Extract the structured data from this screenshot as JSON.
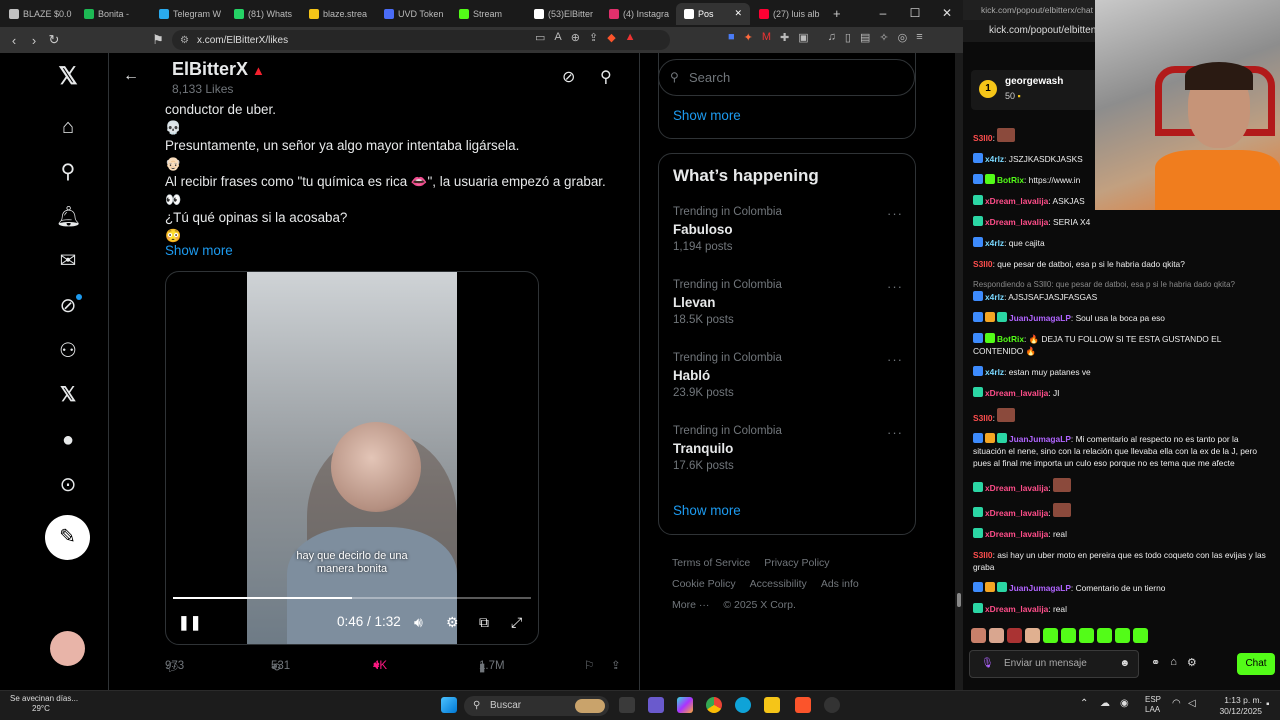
{
  "browser": {
    "tabs": [
      {
        "label": "BLAZE $0.0",
        "color": "#c0c0c0"
      },
      {
        "label": "Bonita -",
        "color": "#1db954"
      },
      {
        "label": "Telegram W",
        "color": "#2aabee"
      },
      {
        "label": "(81) Whats",
        "color": "#25d366"
      },
      {
        "label": "blaze.strea",
        "color": "#f5c518"
      },
      {
        "label": "UVD Token",
        "color": "#4a6cf7"
      },
      {
        "label": "Stream",
        "color": "#53fc18"
      },
      {
        "label": "(53)ElBitter",
        "color": "#ffffff"
      },
      {
        "label": "(4) Instagra",
        "color": "#e1306c"
      },
      {
        "label": "Pos",
        "color": "#ffffff"
      },
      {
        "label": "(27) luis alb",
        "color": "#ff0033"
      }
    ],
    "new_tab": "+",
    "url": "x.com/ElBitterX/likes",
    "window_controls": [
      "–",
      "☐",
      "✕"
    ]
  },
  "x": {
    "header": {
      "name": "ElBitterX",
      "likes": "8,133 Likes"
    },
    "post": {
      "lines": [
        {
          "text": "conductor de uber.",
          "emoji": false
        },
        {
          "text": "💀",
          "emoji": true
        },
        {
          "text": "Presuntamente, un señor ya algo mayor intentaba ligársela.",
          "emoji": false
        },
        {
          "text": "👴🏻",
          "emoji": true
        },
        {
          "text": "Al recibir frases como \"tu química es rica 👄\", la usuaria empezó a grabar.",
          "emoji": false
        },
        {
          "text": "👀",
          "emoji": true
        },
        {
          "text": "¿Tú qué opinas si la acosaba?",
          "emoji": false
        },
        {
          "text": "😳",
          "emoji": true
        }
      ],
      "show_more": "Show more",
      "video": {
        "caption_line1": "hay que decirlo de una",
        "caption_line2": "manera bonita",
        "time": "0:46 / 1:32",
        "progress": 0.5
      },
      "actions": {
        "replies": "973",
        "reposts": "531",
        "likes": "4K",
        "views": "1.7M"
      }
    },
    "sidebar": {
      "search_placeholder": "Search",
      "show_more_top": "Show more",
      "happening_title": "What’s happening",
      "trends": [
        {
          "context": "Trending in Colombia",
          "name": "Fabuloso",
          "posts": "1,194 posts"
        },
        {
          "context": "Trending in Colombia",
          "name": "Llevan",
          "posts": "18.5K posts"
        },
        {
          "context": "Trending in Colombia",
          "name": "Habló",
          "posts": "23.9K posts"
        },
        {
          "context": "Trending in Colombia",
          "name": "Tranquilo",
          "posts": "17.6K posts"
        }
      ],
      "show_more_bottom": "Show more",
      "footer": [
        "Terms of Service",
        "Privacy Policy",
        "Cookie Policy",
        "Accessibility",
        "Ads info",
        "More ···",
        "© 2025 X Corp."
      ]
    }
  },
  "kick": {
    "tab_url": "kick.com/popout/elbitterx/chat",
    "addr": "kick.com/popout/elbitten",
    "gift": {
      "user": "georgewash",
      "amount": "50"
    },
    "messages": [
      {
        "user": "S3ll0",
        "color": "#ff4e4e",
        "text": "",
        "badges": []
      },
      {
        "user": "x4rlz",
        "color": "#7ad8ff",
        "text": "JSZJKASDKJASKS",
        "badges": [
          "#3d8bfd"
        ]
      },
      {
        "user": "BotRix",
        "color": "#53fc18",
        "text": "https://www.in",
        "badges": [
          "#3d8bfd",
          "#53fc18"
        ]
      },
      {
        "user": "xDream_lavalija",
        "color": "#ff4e8a",
        "text": "ASKJAS",
        "badges": [
          "#2bd6a4"
        ]
      },
      {
        "user": "xDream_lavalija",
        "color": "#ff4e8a",
        "text": "SERIA X4",
        "badges": [
          "#2bd6a4"
        ]
      },
      {
        "user": "x4rlz",
        "color": "#7ad8ff",
        "text": "que cajita",
        "badges": [
          "#3d8bfd"
        ]
      },
      {
        "user": "S3ll0",
        "color": "#ff4e4e",
        "text": "que pesar de datboi, esa p si le habria dado qkita?",
        "badges": []
      },
      {
        "reply": "Respondiendo a S3ll0: que pesar de datboi, esa p si le habria dado qkita?",
        "user": "x4rlz",
        "color": "#7ad8ff",
        "text": "AJSJSAFJASJFASGAS",
        "badges": [
          "#3d8bfd"
        ]
      },
      {
        "user": "JuanJumagaLP",
        "color": "#b064ff",
        "text": "Soul usa la boca pa eso",
        "badges": [
          "#3d8bfd",
          "#f5a623",
          "#2bd6a4"
        ]
      },
      {
        "user": "BotRix",
        "color": "#53fc18",
        "text": "🔥 DEJA TU FOLLOW SI TE ESTA GUSTANDO EL CONTENIDO 🔥",
        "badges": [
          "#3d8bfd",
          "#53fc18"
        ]
      },
      {
        "user": "x4rlz",
        "color": "#7ad8ff",
        "text": "estan muy patanes ve",
        "badges": [
          "#3d8bfd"
        ]
      },
      {
        "user": "xDream_lavalija",
        "color": "#ff4e8a",
        "text": "JI",
        "badges": [
          "#2bd6a4"
        ]
      },
      {
        "user": "S3ll0",
        "color": "#ff4e4e",
        "text": "",
        "badges": []
      },
      {
        "user": "JuanJumagaLP",
        "color": "#b064ff",
        "text": "Mi comentario al respecto no es tanto por la situación el nene, sino con la relación que llevaba ella con la ex de la J, pero pues al final me importa un culo eso porque no es tema que me afecte",
        "badges": [
          "#3d8bfd",
          "#f5a623",
          "#2bd6a4"
        ]
      },
      {
        "user": "xDream_lavalija",
        "color": "#ff4e8a",
        "text": "",
        "badges": [
          "#2bd6a4"
        ]
      },
      {
        "user": "xDream_lavalija",
        "color": "#ff4e8a",
        "text": "",
        "badges": [
          "#2bd6a4"
        ]
      },
      {
        "user": "xDream_lavalija",
        "color": "#ff4e8a",
        "text": "real",
        "badges": [
          "#2bd6a4"
        ]
      },
      {
        "user": "S3ll0",
        "color": "#ff4e4e",
        "text": "asi hay un uber moto en pereira que es todo coqueto con las evijas y las graba",
        "badges": []
      },
      {
        "user": "JuanJumagaLP",
        "color": "#b064ff",
        "text": "Comentario de un tierno",
        "badges": [
          "#3d8bfd",
          "#f5a623",
          "#2bd6a4"
        ]
      },
      {
        "user": "xDream_lavalija",
        "color": "#ff4e8a",
        "text": "real",
        "badges": [
          "#2bd6a4"
        ]
      }
    ],
    "input_placeholder": "Enviar un mensaje",
    "chat_button": "Chat"
  },
  "taskbar": {
    "weather_line1": "Se avecinan días...",
    "weather_line2": "29°C",
    "search": "Buscar",
    "lang1": "ESP",
    "lang2": "LAA",
    "time": "1:13 p. m.",
    "date": "30/12/2025"
  }
}
